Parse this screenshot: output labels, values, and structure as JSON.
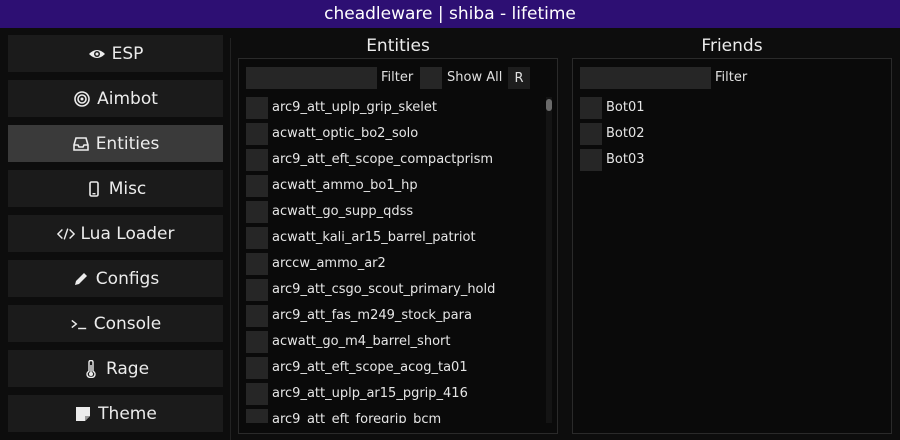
{
  "window": {
    "title": "cheadleware | shiba - lifetime"
  },
  "sidebar": {
    "items": [
      {
        "label": "ESP",
        "icon": "eye-icon",
        "active": false
      },
      {
        "label": "Aimbot",
        "icon": "target-icon",
        "active": false
      },
      {
        "label": "Entities",
        "icon": "inbox-icon",
        "active": true
      },
      {
        "label": "Misc",
        "icon": "phone-icon",
        "active": false
      },
      {
        "label": "Lua Loader",
        "icon": "code-icon",
        "active": false
      },
      {
        "label": "Configs",
        "icon": "pencil-icon",
        "active": false
      },
      {
        "label": "Console",
        "icon": "terminal-icon",
        "active": false
      },
      {
        "label": "Rage",
        "icon": "thermometer-icon",
        "active": false
      },
      {
        "label": "Theme",
        "icon": "note-icon",
        "active": false
      }
    ]
  },
  "entities": {
    "title": "Entities",
    "filter_label": "Filter",
    "filter_value": "",
    "show_all_label": "Show All",
    "refresh_label": "R",
    "items": [
      "arc9_att_uplp_grip_skelet",
      "acwatt_optic_bo2_solo",
      "arc9_att_eft_scope_compactprism",
      "acwatt_ammo_bo1_hp",
      "acwatt_go_supp_qdss",
      "acwatt_kali_ar15_barrel_patriot",
      "arccw_ammo_ar2",
      "arc9_att_csgo_scout_primary_hold",
      "arc9_att_fas_m249_stock_para",
      "acwatt_go_m4_barrel_short",
      "arc9_att_eft_scope_acog_ta01",
      "arc9_att_uplp_ar15_pgrip_416",
      "arc9_att_eft_foregrip_bcm"
    ]
  },
  "friends": {
    "title": "Friends",
    "filter_label": "Filter",
    "filter_value": "",
    "items": [
      "Bot01",
      "Bot02",
      "Bot03"
    ]
  },
  "colors": {
    "titlebar": "#2d0f73",
    "background": "#0d0d0d",
    "button": "#1b1b1b",
    "button_active": "#3a3a3a",
    "checkbox": "#262626"
  }
}
